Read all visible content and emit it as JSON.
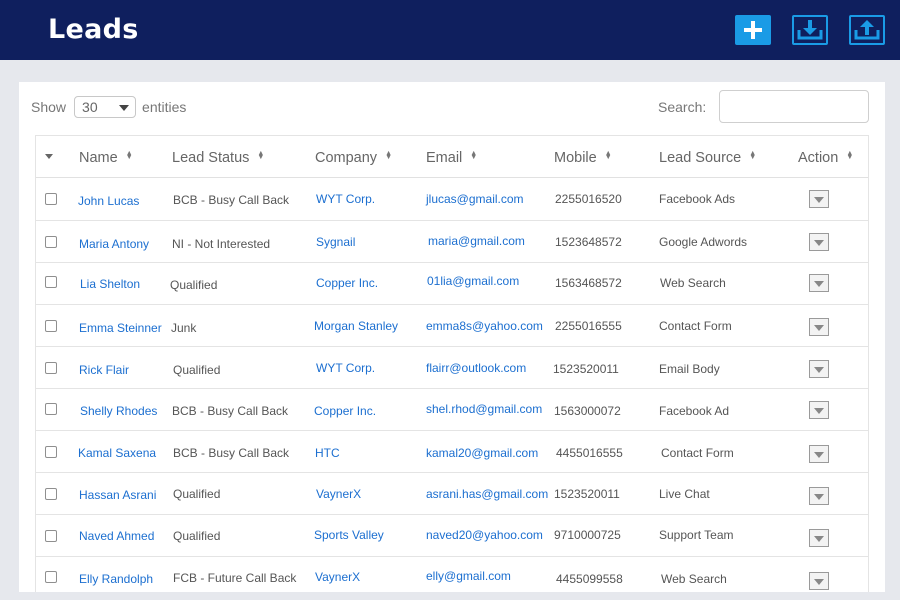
{
  "header": {
    "title": "Leads",
    "buttons": [
      {
        "name": "add-lead-button",
        "icon": "plus-icon"
      },
      {
        "name": "download-button",
        "icon": "download-tray-icon"
      },
      {
        "name": "upload-button",
        "icon": "upload-tray-icon"
      }
    ],
    "accent_color": "#1a9be6",
    "bar_color": "#0f1f5e"
  },
  "controls": {
    "show_label": "Show",
    "entries_value": "30",
    "entities_label": "entities",
    "search_label": "Search:",
    "search_value": ""
  },
  "table": {
    "columns": [
      "Name",
      "Lead Status",
      "Company",
      "Email",
      "Mobile",
      "Lead Source",
      "Action"
    ],
    "rows": [
      {
        "name": "John Lucas",
        "status": "BCB - Busy Call Back",
        "company": "WYT Corp.",
        "email": "jlucas@gmail.com",
        "mobile": "2255016520",
        "source": "Facebook Ads"
      },
      {
        "name": "Maria Antony",
        "status": "NI - Not Interested",
        "company": "Sygnail",
        "email": "maria@gmail.com",
        "mobile": "1523648572",
        "source": "Google Adwords"
      },
      {
        "name": "Lia Shelton",
        "status": "Qualified",
        "company": "Copper Inc.",
        "email": "01lia@gmail.com",
        "mobile": "1563468572",
        "source": "Web Search"
      },
      {
        "name": "Emma Steinner",
        "status": "Junk",
        "company": "Morgan Stanley",
        "email": "emma8s@yahoo.com",
        "mobile": "2255016555",
        "source": "Contact Form"
      },
      {
        "name": "Rick Flair",
        "status": "Qualified",
        "company": "WYT Corp.",
        "email": "flairr@outlook.com",
        "mobile": "1523520011",
        "source": "Email Body"
      },
      {
        "name": "Shelly Rhodes",
        "status": "BCB - Busy Call Back",
        "company": "Copper Inc.",
        "email": "shel.rhod@gmail.com",
        "mobile": "1563000072",
        "source": "Facebook Ad"
      },
      {
        "name": "Kamal Saxena",
        "status": "BCB - Busy Call Back",
        "company": "HTC",
        "email": "kamal20@gmail.com",
        "mobile": "4455016555",
        "source": "Contact Form"
      },
      {
        "name": "Hassan Asrani",
        "status": "Qualified",
        "company": "VaynerX",
        "email": "asrani.has@gmail.com",
        "mobile": "1523520011",
        "source": "Live Chat"
      },
      {
        "name": "Naved Ahmed",
        "status": "Qualified",
        "company": "Sports Valley",
        "email": "naved20@yahoo.com",
        "mobile": "9710000725",
        "source": "Support Team"
      },
      {
        "name": "Elly Randolph",
        "status": "FCB - Future Call Back",
        "company": "VaynerX",
        "email": "elly@gmail.com",
        "mobile": "4455099558",
        "source": "Web Search"
      }
    ]
  }
}
